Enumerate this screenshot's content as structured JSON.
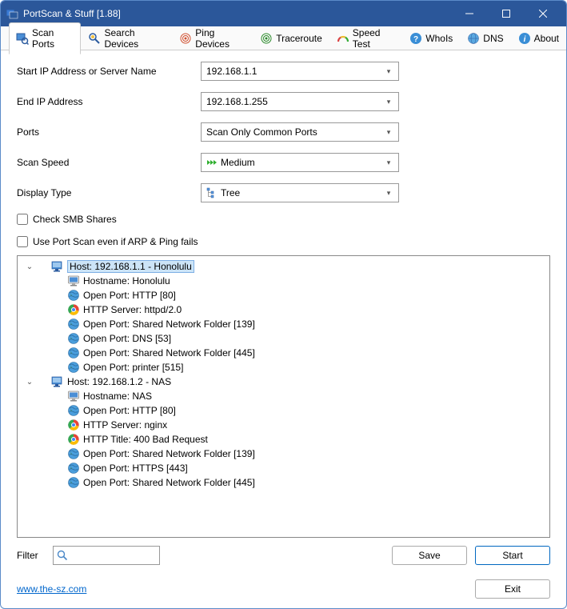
{
  "window": {
    "title": "PortScan & Stuff [1.88]"
  },
  "tabs": [
    {
      "label": "Scan Ports"
    },
    {
      "label": "Search Devices"
    },
    {
      "label": "Ping Devices"
    },
    {
      "label": "Traceroute"
    },
    {
      "label": "Speed Test"
    },
    {
      "label": "WhoIs"
    },
    {
      "label": "DNS"
    },
    {
      "label": "About"
    }
  ],
  "form": {
    "start_ip_label": "Start IP Address or Server Name",
    "start_ip_value": "192.168.1.1",
    "end_ip_label": "End IP Address",
    "end_ip_value": "192.168.1.255",
    "ports_label": "Ports",
    "ports_value": "Scan Only Common Ports",
    "speed_label": "Scan Speed",
    "speed_value": "Medium",
    "display_label": "Display Type",
    "display_value": "Tree",
    "chk_smb": "Check SMB Shares",
    "chk_arp": "Use Port Scan even if ARP & Ping fails"
  },
  "results": {
    "hosts": [
      {
        "label": "Host: 192.168.1.1 - Honolulu",
        "selected": true,
        "items": [
          {
            "icon": "monitor",
            "text": "Hostname: Honolulu"
          },
          {
            "icon": "globe",
            "text": "Open Port: HTTP [80]"
          },
          {
            "icon": "chrome",
            "text": "HTTP Server: httpd/2.0"
          },
          {
            "icon": "globe",
            "text": "Open Port: Shared Network Folder [139]"
          },
          {
            "icon": "globe",
            "text": "Open Port: DNS [53]"
          },
          {
            "icon": "globe",
            "text": "Open Port: Shared Network Folder [445]"
          },
          {
            "icon": "globe",
            "text": "Open Port: printer [515]"
          }
        ]
      },
      {
        "label": "Host: 192.168.1.2 - NAS",
        "selected": false,
        "items": [
          {
            "icon": "monitor",
            "text": "Hostname: NAS"
          },
          {
            "icon": "globe",
            "text": "Open Port: HTTP [80]"
          },
          {
            "icon": "chrome",
            "text": "HTTP Server: nginx"
          },
          {
            "icon": "chrome",
            "text": "HTTP Title: 400 Bad Request"
          },
          {
            "icon": "globe",
            "text": "Open Port: Shared Network Folder [139]"
          },
          {
            "icon": "globe",
            "text": "Open Port: HTTPS [443]"
          },
          {
            "icon": "globe",
            "text": "Open Port: Shared Network Folder [445]"
          }
        ]
      }
    ]
  },
  "bottom": {
    "filter_label": "Filter",
    "save_label": "Save",
    "start_label": "Start",
    "exit_label": "Exit"
  },
  "footer": {
    "link": "www.the-sz.com"
  }
}
